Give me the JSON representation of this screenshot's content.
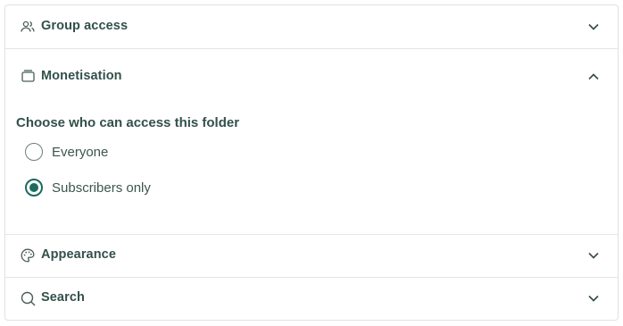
{
  "sections": {
    "group_access": {
      "label": "Group access",
      "icon": "group-icon",
      "expanded": false
    },
    "monetisation": {
      "label": "Monetisation",
      "icon": "folder-icon",
      "expanded": true,
      "question": "Choose who can access this folder",
      "options": [
        {
          "label": "Everyone",
          "selected": false
        },
        {
          "label": "Subscribers only",
          "selected": true
        }
      ]
    },
    "appearance": {
      "label": "Appearance",
      "icon": "palette-icon",
      "expanded": false
    },
    "search": {
      "label": "Search",
      "icon": "search-icon",
      "expanded": false
    }
  },
  "colors": {
    "accent": "#1d6b5e",
    "text": "#33504b",
    "border": "#dfe3e2"
  }
}
